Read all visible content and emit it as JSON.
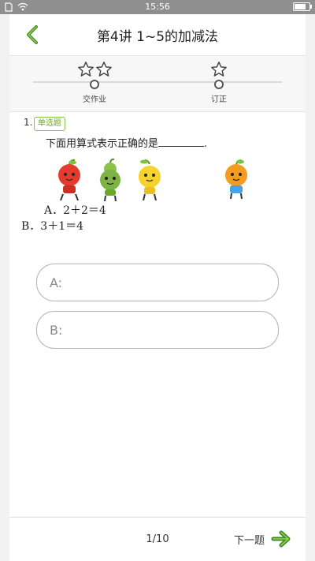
{
  "status_bar": {
    "time": "15:56"
  },
  "header": {
    "title": "第4讲 1~5的加减法"
  },
  "progress": {
    "steps": [
      {
        "label": "交作业",
        "stars": 2
      },
      {
        "label": "订正",
        "stars": 1
      }
    ]
  },
  "question": {
    "number": "1.",
    "type_tag": "单选题",
    "text": "下面用算式表示正确的是",
    "text_end": ".",
    "option_a": "A．2＋2＝4",
    "option_b": "B．3＋1＝4"
  },
  "answers": {
    "a_label": "A:",
    "b_label": "B:"
  },
  "footer": {
    "page_indicator": "1/10",
    "next_label": "下一题"
  },
  "colors": {
    "accent_green": "#6aa82b",
    "header_back": "#3d8c1c"
  }
}
